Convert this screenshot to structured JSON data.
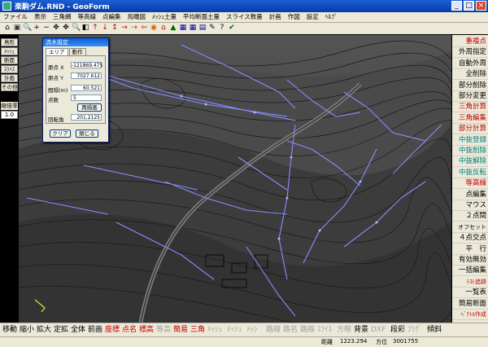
{
  "window": {
    "title": "楽駒ダム.RND - GeoForm",
    "min": "_",
    "max": "□",
    "close": "×"
  },
  "menu": [
    "ファイル",
    "表示",
    "三角網",
    "等高線",
    "点編集",
    "鳥瞰図",
    "ﾒｯｼｭ土量",
    "平均断面土量",
    "スライス数量",
    "計画",
    "作図",
    "設定",
    "ﾍﾙﾌﾟ"
  ],
  "toolbar": [
    "⌂",
    "▣",
    "🔍",
    "+",
    "−",
    "✥",
    "✥",
    "🔍",
    "◧",
    "↑",
    "↓",
    "↕",
    "→",
    "⇢",
    "⇦",
    "◉",
    "⌂",
    "▲",
    "▦",
    "▦",
    "▤",
    "✎",
    "?",
    "✔"
  ],
  "left_panel": {
    "buttons": [
      "鳥形",
      "ﾒｯｼｭ",
      "断面",
      "ｽﾗｲｽ",
      "計画",
      "その他"
    ],
    "scale_label": "縮倍率",
    "scale_value": "1.0"
  },
  "dialog": {
    "title": "流水設定",
    "tabs": [
      "エリア",
      "動作"
    ],
    "fields": [
      {
        "label": "原点 X",
        "value": "-121869.475"
      },
      {
        "label": "原点 Y",
        "value": "7027.612"
      },
      {
        "label": "間隔(m)",
        "value": "60.521"
      },
      {
        "label": "点数",
        "value": "5"
      },
      {
        "label": "回転角",
        "value": "201.2125"
      }
    ],
    "redraw_button": "再描画",
    "clear_button": "クリア",
    "close_button": "閉じる"
  },
  "right_panel": [
    {
      "label": "重複点",
      "color": "#c00000"
    },
    {
      "label": "外周指定",
      "color": "#000000"
    },
    {
      "label": "自動外周",
      "color": "#000000"
    },
    {
      "label": "全削除",
      "color": "#000000"
    },
    {
      "label": "部分削除",
      "color": "#000000"
    },
    {
      "label": "部分変更",
      "color": "#000000"
    },
    {
      "label": "三角計算",
      "color": "#c00000"
    },
    {
      "label": "三角編集",
      "color": "#c00000"
    },
    {
      "label": "部分計算",
      "color": "#c00000"
    },
    {
      "label": "中抜登録",
      "color": "#008080"
    },
    {
      "label": "中抜削除",
      "color": "#008080"
    },
    {
      "label": "中抜解除",
      "color": "#008080"
    },
    {
      "label": "中抜反転",
      "color": "#008080"
    },
    {
      "label": "等高線",
      "color": "#c00000"
    },
    {
      "label": "点編集",
      "color": "#000000"
    },
    {
      "label": "マウス",
      "color": "#000000"
    },
    {
      "label": "２点間",
      "color": "#000000"
    },
    {
      "label": "オフセット",
      "color": "#000000"
    },
    {
      "label": "４点交点",
      "color": "#000000"
    },
    {
      "label": "平　行",
      "color": "#000000"
    },
    {
      "label": "有効無効",
      "color": "#000000"
    },
    {
      "label": "一括編集",
      "color": "#000000"
    },
    {
      "label": "ﾃｽﾄ追跡",
      "color": "#c00000"
    },
    {
      "label": "一覧表",
      "color": "#000000"
    },
    {
      "label": "簡易断面",
      "color": "#000000"
    },
    {
      "label": "ﾍﾞｸﾄﾙ作成",
      "color": "#c00000"
    }
  ],
  "bottom_bar": [
    {
      "label": "移動",
      "color": "#000000"
    },
    {
      "label": "縮小",
      "color": "#000000"
    },
    {
      "label": "拡大",
      "color": "#000000"
    },
    {
      "label": "定拡",
      "color": "#000000"
    },
    {
      "label": "全体",
      "color": "#000000"
    },
    {
      "label": "前画",
      "color": "#000000"
    },
    {
      "label": "座標",
      "color": "#c00000"
    },
    {
      "label": "点名",
      "color": "#c00000"
    },
    {
      "label": "標高",
      "color": "#c00000"
    },
    {
      "label": "等高",
      "color": "#a0a0a0"
    },
    {
      "label": "簡易",
      "color": "#c00000"
    },
    {
      "label": "三角",
      "color": "#c00000"
    },
    {
      "label": "ﾒｯｼｭ",
      "color": "#a0a0a0"
    },
    {
      "label": "ﾒｯｼｭ",
      "color": "#a0a0a0"
    },
    {
      "label": "ﾒｯｼ",
      "color": "#a0a0a0"
    },
    {
      "label": "路線",
      "color": "#a0a0a0"
    },
    {
      "label": "路名",
      "color": "#a0a0a0"
    },
    {
      "label": "路線",
      "color": "#a0a0a0"
    },
    {
      "label": "ｽﾗｲｽ",
      "color": "#a0a0a0"
    },
    {
      "label": "方眼",
      "color": "#a0a0a0"
    },
    {
      "label": "背景",
      "color": "#000000"
    },
    {
      "label": "DXF",
      "color": "#a0a0a0"
    },
    {
      "label": "段彩",
      "color": "#000000"
    },
    {
      "label": "ﾌﾗｸﾞ",
      "color": "#a0a0a0"
    },
    {
      "label": "傾斜",
      "color": "#000000"
    }
  ],
  "status": {
    "distance_label": "距離",
    "distance": "1223.294",
    "angle_label": "方位",
    "angle": "3001755"
  },
  "colors": {
    "flow_line": "#8a8cff",
    "contour": "#1a1a1a",
    "terrain_dark": "#3a3a3a",
    "terrain_light": "#7a7a7a"
  }
}
